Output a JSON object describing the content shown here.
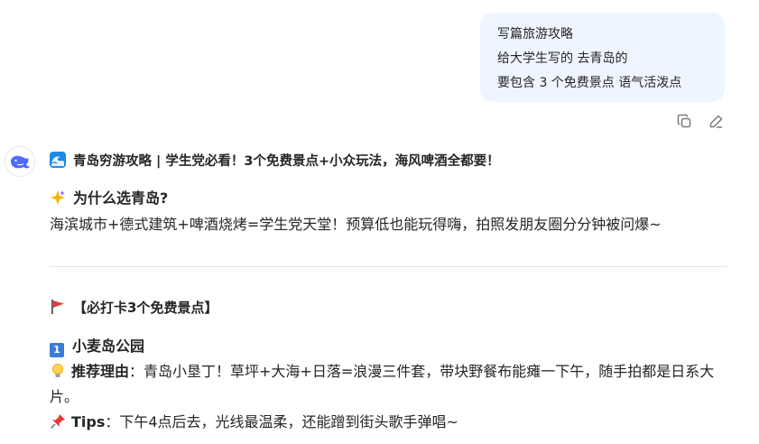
{
  "user_message": {
    "lines": [
      "写篇旅游攻略",
      "给大学生写的  去青岛的",
      "要包含 3 个免费景点 语气活泼点"
    ]
  },
  "message_actions": {
    "copy_icon": "copy-icon",
    "edit_icon": "edit-icon"
  },
  "assistant": {
    "avatar_icon": "whale-logo-icon",
    "title": "青岛穷游攻略 | 学生党必看！3个免费景点+小众玩法，海风啤酒全都要！",
    "why": {
      "heading": "为什么选青岛?",
      "body": "海滨城市+德式建筑+啤酒烧烤=学生党天堂！预算低也能玩得嗨，拍照发朋友圈分分钟被问爆~"
    },
    "section": {
      "heading": "【必打卡3个免费景点】",
      "spot1": {
        "number": "1",
        "name": "小麦岛公园",
        "reason_label": "推荐理由",
        "reason_text": "：青岛小垦丁！草坪+大海+日落=浪漫三件套，带块野餐布能瘫一下午，随手拍都是日系大片。",
        "tips_label": "Tips",
        "tips_text": "：下午4点后去，光线最温柔，还能蹭到街头歌手弹唱~"
      }
    }
  },
  "colors": {
    "bubble_bg": "#eef5ff",
    "accent": "#4d6bfe",
    "divider": "#e6e6e6"
  }
}
